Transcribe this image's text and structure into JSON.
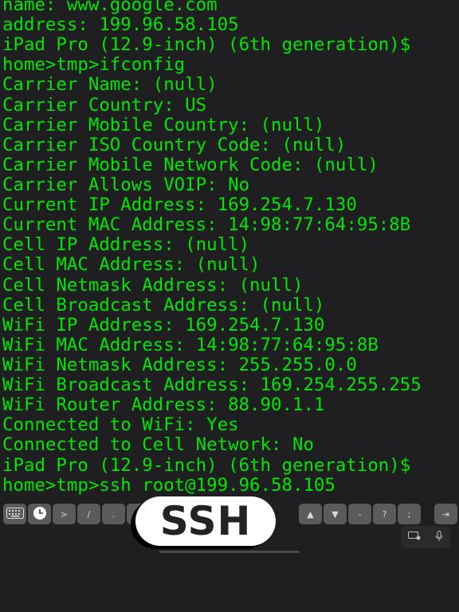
{
  "colors": {
    "background": "#1f1f21",
    "terminal_text": "#00e600",
    "key": "#5b5b5e"
  },
  "terminal": {
    "lines": [
      "name: www.google.com",
      "address: 199.96.58.105",
      "iPad Pro (12.9-inch) (6th generation)$",
      "home>tmp>ifconfig",
      "Carrier Name: (null)",
      "Carrier Country: US",
      "Carrier Mobile Country: (null)",
      "Carrier ISO Country Code: (null)",
      "Carrier Mobile Network Code: (null)",
      "Carrier Allows VOIP: No",
      "Current IP Address: 169.254.7.130",
      "Current MAC Address: 14:98:77:64:95:8B",
      "Cell IP Address: (null)",
      "Cell MAC Address: (null)",
      "Cell Netmask Address: (null)",
      "Cell Broadcast Address: (null)",
      "WiFi IP Address: 169.254.7.130",
      "WiFi MAC Address: 14:98:77:64:95:8B",
      "WiFi Netmask Address: 255.255.0.0",
      "WiFi Broadcast Address: 169.254.255.255",
      "WiFi Router Address: 88.90.1.1",
      "Connected to WiFi: Yes",
      "Connected to Cell Network: No",
      "iPad Pro (12.9-inch) (6th generation)$",
      "home>tmp>ssh root@199.96.58.105"
    ]
  },
  "accessory_bar": {
    "keys": [
      ">",
      "/",
      ".",
      ":",
      "▲",
      "▼",
      "-",
      "?",
      ";",
      "⇥"
    ],
    "icons": [
      "keyboard-icon",
      "clock-icon"
    ]
  },
  "badge": {
    "label": "SSH"
  }
}
